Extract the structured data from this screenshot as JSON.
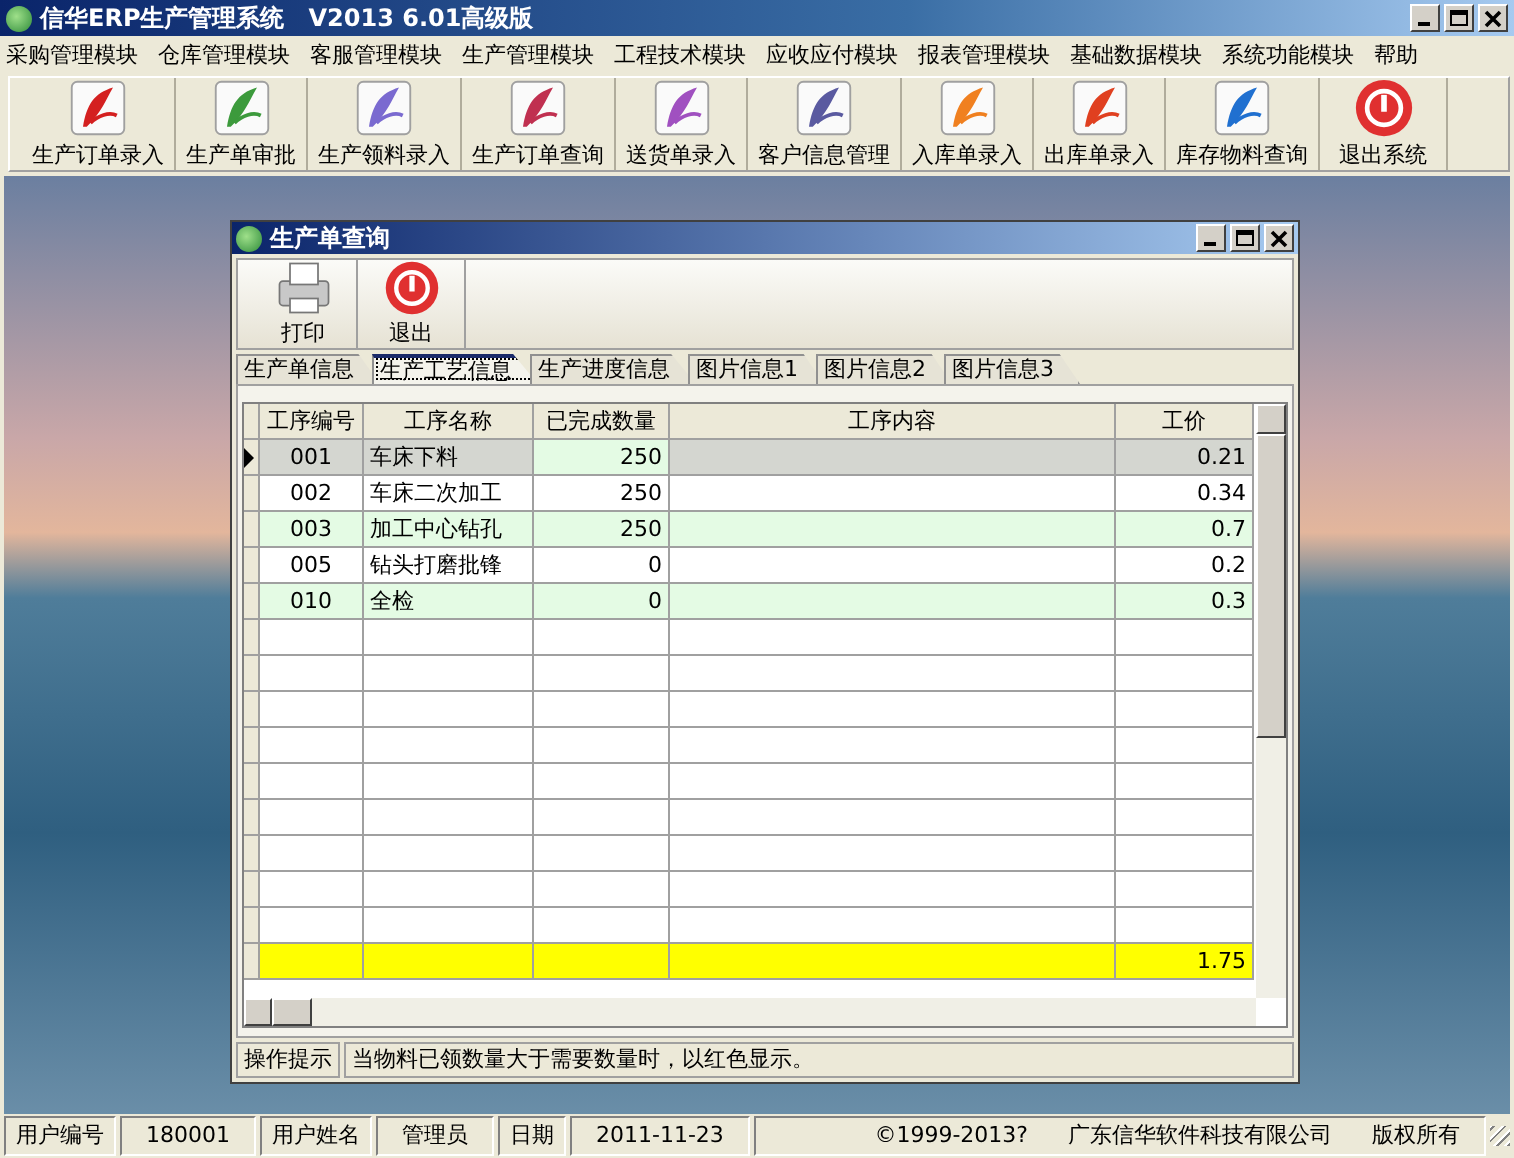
{
  "window": {
    "title": "信华ERP生产管理系统　V2013 6.01高级版"
  },
  "menu": [
    "采购管理模块",
    "仓库管理模块",
    "客服管理模块",
    "生产管理模块",
    "工程技术模块",
    "应收应付模块",
    "报表管理模块",
    "基础数据模块",
    "系统功能模块",
    "帮助"
  ],
  "toolbar": [
    "生产订单录入",
    "生产单审批",
    "生产领料录入",
    "生产订单查询",
    "送货单录入",
    "客户信息管理",
    "入库单录入",
    "出库单录入",
    "库存物料查询",
    "退出系统"
  ],
  "child_window": {
    "title": "生产单查询",
    "toolbar": [
      "打印",
      "退出"
    ],
    "tabs": [
      {
        "label": "生产单信息",
        "selected": false
      },
      {
        "label": "生产工艺信息",
        "selected": true
      },
      {
        "label": "生产进度信息",
        "selected": false
      },
      {
        "label": "图片信息1",
        "selected": false
      },
      {
        "label": "图片信息2",
        "selected": false
      },
      {
        "label": "图片信息3",
        "selected": false
      }
    ],
    "table": {
      "columns": [
        "工序编号",
        "工序名称",
        "已完成数量",
        "工序内容",
        "工价"
      ],
      "rows": [
        {
          "cells": [
            "001",
            "车床下料",
            "250",
            "0.21"
          ],
          "selected": true
        },
        {
          "cells": [
            "002",
            "车床二次加工",
            "250",
            "0.34"
          ],
          "selected": false
        },
        {
          "cells": [
            "003",
            "加工中心钻孔",
            "250",
            "0.7"
          ],
          "selected": false
        },
        {
          "cells": [
            "005",
            "钻头打磨批锋",
            "0",
            "0.2"
          ],
          "selected": false
        },
        {
          "cells": [
            "010",
            "全检",
            "0",
            "0.3"
          ],
          "selected": false
        }
      ],
      "total_price": "1.75"
    },
    "hint": {
      "label": "操作提示",
      "text": "当物料已领数量大于需要数量时，以红色显示。"
    }
  },
  "status_bar": [
    {
      "text": "用户编号",
      "kind": "label"
    },
    {
      "text": "180001",
      "kind": "value"
    },
    {
      "text": "用户姓名",
      "kind": "label"
    },
    {
      "text": "管理员",
      "kind": "value"
    },
    {
      "text": "日期",
      "kind": "label"
    },
    {
      "text": "2011-11-23",
      "kind": "value"
    },
    {
      "text": "©1999-2013?",
      "kind": "info"
    },
    {
      "text": "广东信华软件科技有限公司",
      "kind": "info"
    },
    {
      "text": "版权所有",
      "kind": "info"
    }
  ]
}
